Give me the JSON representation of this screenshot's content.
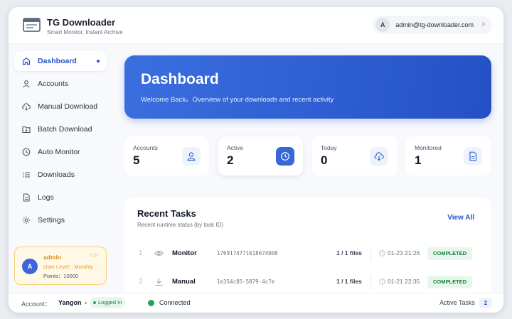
{
  "app": {
    "title": "TG Downloader",
    "subtitle": "Smart Monitor, Instant Archive"
  },
  "user": {
    "avatar": "A",
    "email": "admin@tg-downloader.com",
    "close": "×"
  },
  "sidebar": {
    "items": [
      {
        "label": "Dashboard",
        "icon": "home-icon",
        "active": true
      },
      {
        "label": "Accounts",
        "icon": "user-icon"
      },
      {
        "label": "Manual Download",
        "icon": "cloud-download-icon"
      },
      {
        "label": "Batch Download",
        "icon": "folder-download-icon"
      },
      {
        "label": "Auto Monitor",
        "icon": "clock-icon"
      },
      {
        "label": "Downloads",
        "icon": "list-icon"
      },
      {
        "label": "Logs",
        "icon": "file-icon"
      },
      {
        "label": "Settings",
        "icon": "gear-icon"
      }
    ],
    "user_card": {
      "avatar": "A",
      "name": "admin",
      "level": "User Level：Monthly VIP",
      "points": "Points：10000",
      "badge": "VIP"
    }
  },
  "hero": {
    "title": "Dashboard",
    "subtitle": "Welcome Back。Overview of your downloads and recent activity"
  },
  "stats": [
    {
      "label": "Accounts",
      "value": "5",
      "icon": "user-icon"
    },
    {
      "label": "Active",
      "value": "2",
      "icon": "clock-icon"
    },
    {
      "label": "Today",
      "value": "0",
      "icon": "download-icon"
    },
    {
      "label": "Monitored",
      "value": "1",
      "icon": "document-icon"
    }
  ],
  "recent_tasks": {
    "title": "Recent Tasks",
    "subtitle": "Recent runtime status (by task ID)",
    "view_all": "View All",
    "rows": [
      {
        "index": "1",
        "icon": "eye-icon",
        "type": "Monitor",
        "task_id": "1769174771618674008",
        "files": "1 / 1 files",
        "time": "01-23 21:26",
        "status": "COMPLETED"
      },
      {
        "index": "2",
        "icon": "download-icon",
        "type": "Manual",
        "task_id": "1e354c85-5879-4c7e",
        "files": "1 / 1 files",
        "time": "01-21 22:35",
        "status": "COMPLETED"
      }
    ]
  },
  "footer": {
    "account_label": "Account：",
    "account_name": "Yangon",
    "logged_in": "Logged In",
    "connection": "Connected",
    "active_tasks_label": "Active Tasks",
    "active_tasks_count": "2"
  },
  "colors": {
    "accent": "#2554c7",
    "success": "#22a35a",
    "vip": "#d98c12"
  }
}
